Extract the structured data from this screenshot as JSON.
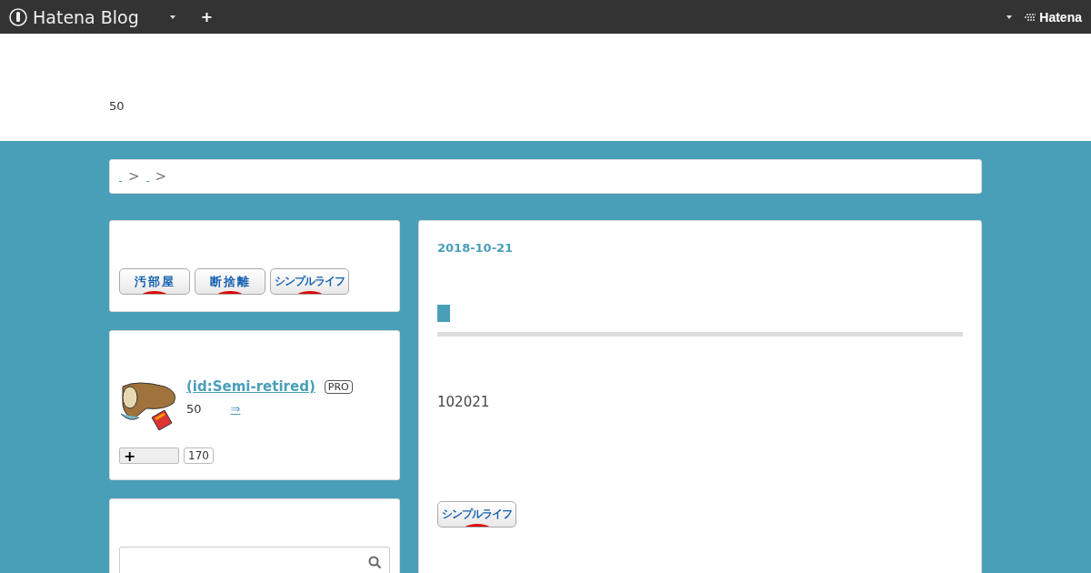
{
  "topbar": {
    "brand": "Hatena Blog",
    "add": "+",
    "account_brand": "Hatena"
  },
  "header": {
    "description": "50"
  },
  "breadcrumb": {
    "separators": [
      ">",
      ">"
    ]
  },
  "sidebar": {
    "banners": [
      {
        "label": "汚部屋"
      },
      {
        "label": "断捨離"
      },
      {
        "label": "シンプルライフ"
      }
    ],
    "profile": {
      "name": " (id:Semi-retired)",
      "badge": "PRO",
      "stat": "50",
      "more": "⇒",
      "follow": "+",
      "followers": "170"
    }
  },
  "entry": {
    "date": "2018-10-21",
    "body": "102021",
    "banner": "シンプルライフ"
  }
}
